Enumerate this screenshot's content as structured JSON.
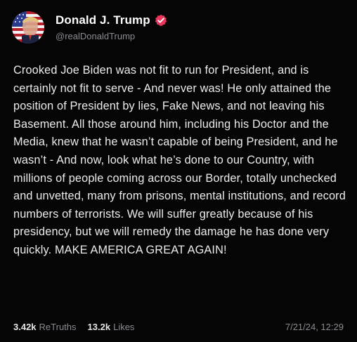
{
  "author": {
    "display_name": "Donald J. Trump",
    "handle": "@realDonaldTrump",
    "verified": true,
    "avatar_icon": "flag-portrait-avatar",
    "verified_icon": "verified-badge-icon",
    "verified_color": "#e8365d"
  },
  "post": {
    "text": "Crooked Joe Biden was not fit to run for President, and is certainly not fit to serve - And never was! He only attained the position of President by lies, Fake News, and not leaving his Basement. All those around him, including his Doctor and the Media, knew that he wasn’t capable of being President, and he wasn’t - And now, look what he’s done to our Country, with millions of people coming across our Border, totally unchecked and unvetted, many from prisons, mental institutions, and record numbers of terrorists. We will suffer greatly because of his presidency, but we will remedy the damage he has done very quickly. MAKE AMERICA GREAT AGAIN!"
  },
  "stats": {
    "retruths_count": "3.42k",
    "retruths_label": "ReTruths",
    "likes_count": "13.2k",
    "likes_label": "Likes"
  },
  "timestamp": "7/21/24, 12:29",
  "colors": {
    "background": "#050505",
    "text": "#ececee",
    "muted": "#8b8b93"
  }
}
